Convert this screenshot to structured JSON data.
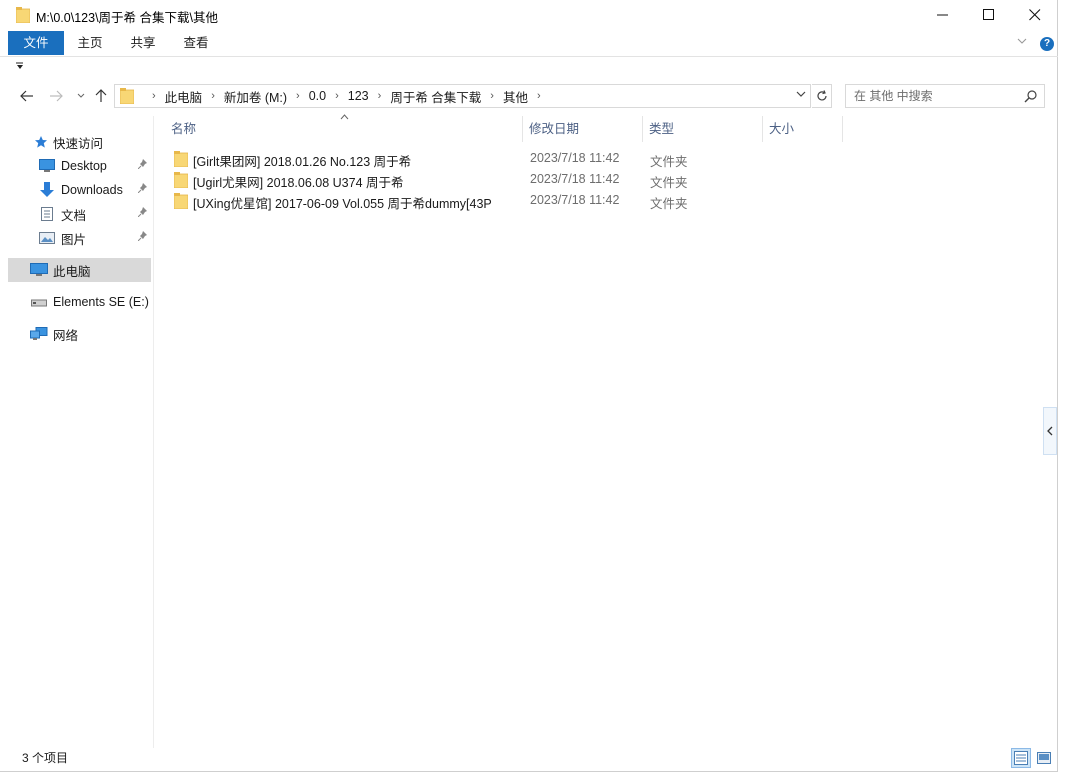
{
  "window": {
    "title": "M:\\0.0\\123\\周于希 合集下载\\其他",
    "minimize_glyph": "—",
    "maximize_glyph": "☐",
    "close_glyph": "✕"
  },
  "ribbon": {
    "tabs": [
      "文件",
      "主页",
      "共享",
      "查看"
    ],
    "active_tab": "文件",
    "accent_color": "#1a6fbe"
  },
  "address_bar": {
    "crumbs": [
      "此电脑",
      "新加卷 (M:)",
      "0.0",
      "123",
      "周于希 合集下载",
      "其他"
    ]
  },
  "search": {
    "placeholder": "在 其他 中搜索",
    "value": ""
  },
  "nav_pane": {
    "quick_access": "快速访问",
    "items": [
      {
        "label": "Desktop",
        "icon": "desktop-icon",
        "pinned": true
      },
      {
        "label": "Downloads",
        "icon": "downloads-icon",
        "pinned": true
      },
      {
        "label": "文档",
        "icon": "documents-icon",
        "pinned": true
      },
      {
        "label": "图片",
        "icon": "pictures-icon",
        "pinned": true
      }
    ],
    "this_pc": "此电脑",
    "drive": "Elements SE (E:)",
    "network": "网络"
  },
  "columns": {
    "name": "名称",
    "date": "修改日期",
    "type": "类型",
    "size": "大小"
  },
  "files": [
    {
      "name": "[Girlt果团网] 2018.01.26 No.123  周于希",
      "date": "2023/7/18 11:42",
      "type": "文件夹"
    },
    {
      "name": "[Ugirl尤果网] 2018.06.08 U374 周于希",
      "date": "2023/7/18 11:42",
      "type": "文件夹"
    },
    {
      "name": "[UXing优星馆] 2017-06-09 Vol.055 周于希dummy[43P",
      "date": "2023/7/18 11:42",
      "type": "文件夹"
    }
  ],
  "status_bar": {
    "item_count": "3 个项目"
  },
  "colors": {
    "folder": "#f8d775",
    "folder_dark": "#e8b84a",
    "selected_nav": "#d9d9d9",
    "header_text": "#4d6185"
  }
}
